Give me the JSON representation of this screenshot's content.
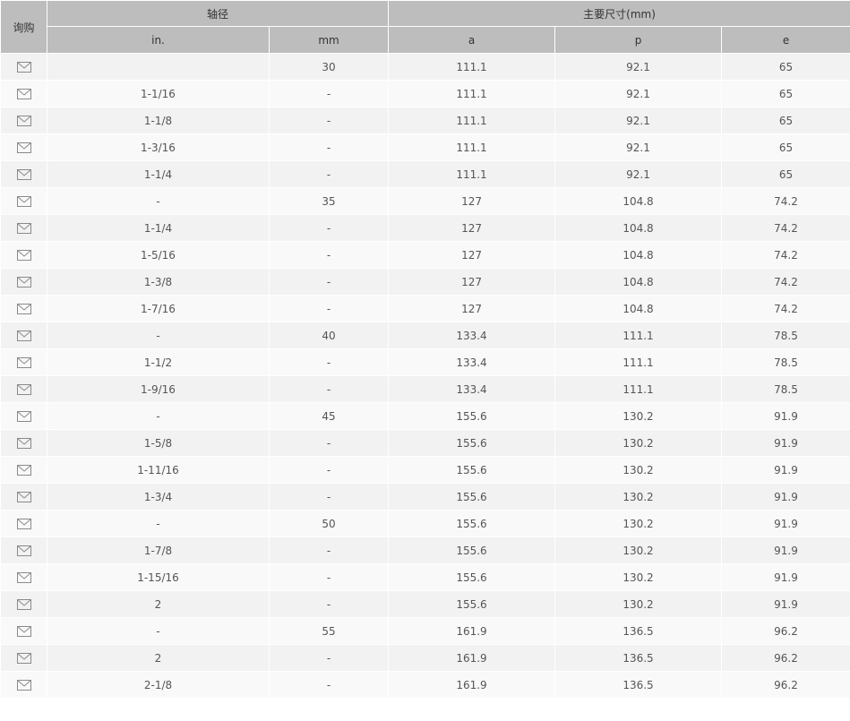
{
  "header": {
    "inquiry": "询购",
    "shaft_group": "轴径",
    "dims_group": "主要尺寸(mm)",
    "columns": [
      "in.",
      "mm",
      "a",
      "p",
      "e"
    ]
  },
  "row_icon": "mail-icon",
  "rows": [
    {
      "inch": "",
      "mm": "30",
      "a": "111.1",
      "p": "92.1",
      "e": "65"
    },
    {
      "inch": "1-1/16",
      "mm": "-",
      "a": "111.1",
      "p": "92.1",
      "e": "65"
    },
    {
      "inch": "1-1/8",
      "mm": "-",
      "a": "111.1",
      "p": "92.1",
      "e": "65"
    },
    {
      "inch": "1-3/16",
      "mm": "-",
      "a": "111.1",
      "p": "92.1",
      "e": "65"
    },
    {
      "inch": "1-1/4",
      "mm": "-",
      "a": "111.1",
      "p": "92.1",
      "e": "65"
    },
    {
      "inch": "-",
      "mm": "35",
      "a": "127",
      "p": "104.8",
      "e": "74.2"
    },
    {
      "inch": "1-1/4",
      "mm": "-",
      "a": "127",
      "p": "104.8",
      "e": "74.2"
    },
    {
      "inch": "1-5/16",
      "mm": "-",
      "a": "127",
      "p": "104.8",
      "e": "74.2"
    },
    {
      "inch": "1-3/8",
      "mm": "-",
      "a": "127",
      "p": "104.8",
      "e": "74.2"
    },
    {
      "inch": "1-7/16",
      "mm": "-",
      "a": "127",
      "p": "104.8",
      "e": "74.2"
    },
    {
      "inch": "-",
      "mm": "40",
      "a": "133.4",
      "p": "111.1",
      "e": "78.5"
    },
    {
      "inch": "1-1/2",
      "mm": "-",
      "a": "133.4",
      "p": "111.1",
      "e": "78.5"
    },
    {
      "inch": "1-9/16",
      "mm": "-",
      "a": "133.4",
      "p": "111.1",
      "e": "78.5"
    },
    {
      "inch": "-",
      "mm": "45",
      "a": "155.6",
      "p": "130.2",
      "e": "91.9"
    },
    {
      "inch": "1-5/8",
      "mm": "-",
      "a": "155.6",
      "p": "130.2",
      "e": "91.9"
    },
    {
      "inch": "1-11/16",
      "mm": "-",
      "a": "155.6",
      "p": "130.2",
      "e": "91.9"
    },
    {
      "inch": "1-3/4",
      "mm": "-",
      "a": "155.6",
      "p": "130.2",
      "e": "91.9"
    },
    {
      "inch": "-",
      "mm": "50",
      "a": "155.6",
      "p": "130.2",
      "e": "91.9"
    },
    {
      "inch": "1-7/8",
      "mm": "-",
      "a": "155.6",
      "p": "130.2",
      "e": "91.9"
    },
    {
      "inch": "1-15/16",
      "mm": "-",
      "a": "155.6",
      "p": "130.2",
      "e": "91.9"
    },
    {
      "inch": "2",
      "mm": "-",
      "a": "155.6",
      "p": "130.2",
      "e": "91.9"
    },
    {
      "inch": "-",
      "mm": "55",
      "a": "161.9",
      "p": "136.5",
      "e": "96.2"
    },
    {
      "inch": "2",
      "mm": "-",
      "a": "161.9",
      "p": "136.5",
      "e": "96.2"
    },
    {
      "inch": "2-1/8",
      "mm": "-",
      "a": "161.9",
      "p": "136.5",
      "e": "96.2"
    }
  ]
}
